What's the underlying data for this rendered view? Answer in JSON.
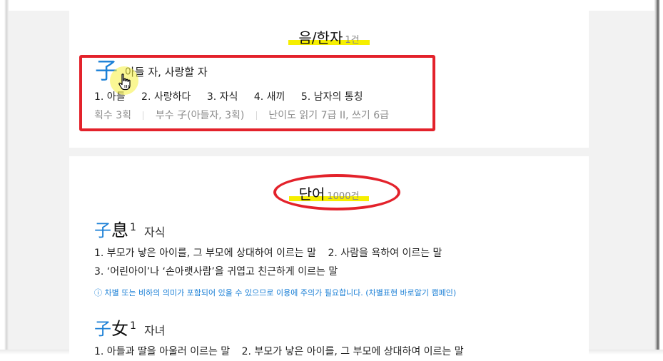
{
  "hanja_section": {
    "title": "음/한자",
    "count": "1건",
    "entry": {
      "character": "子",
      "meaning": "아들 자, 사랑할 자",
      "senses": [
        "1. 아들",
        "2. 사랑하다",
        "3. 자식",
        "4. 새끼",
        "5. 남자의 통칭"
      ],
      "strokes_label": "획수",
      "strokes_value": "3획",
      "radical_label": "부수",
      "radical_value": "子(아들자, 3획)",
      "difficulty_label": "난이도",
      "difficulty_value": "읽기 7급 II, 쓰기 6급"
    }
  },
  "words_section": {
    "title": "단어",
    "count": "1000건",
    "entries": [
      {
        "char1": "子",
        "char2": "息",
        "num": "1",
        "reading": "자식",
        "lines": [
          [
            "1. 부모가 낳은 아이를, 그 부모에 상대하여 이르는 말",
            "2. 사람을 욕하여 이르는 말"
          ],
          [
            "3. ‘어린아이’나 ‘손아랫사람’을 귀엽고 친근하게 이르는 말"
          ]
        ],
        "notice": "ⓘ 차별 또는 비하의 의미가 포함되어 있을 수 있으므로 이용에 주의가 필요합니다. (차별표현 바로알기 캠페인)"
      },
      {
        "char1": "子",
        "char2": "女",
        "num": "1",
        "reading": "자녀",
        "lines": [
          [
            "1. 아들과 딸을 아울러 이르는 말",
            "2. 부모가 낳은 아이를, 그 부모에 상대하여 이르는 말"
          ]
        ]
      }
    ]
  },
  "colors": {
    "accent_blue": "#1a7fd6",
    "highlight_yellow": "#f6ef00",
    "annotation_red": "#e3222b"
  }
}
